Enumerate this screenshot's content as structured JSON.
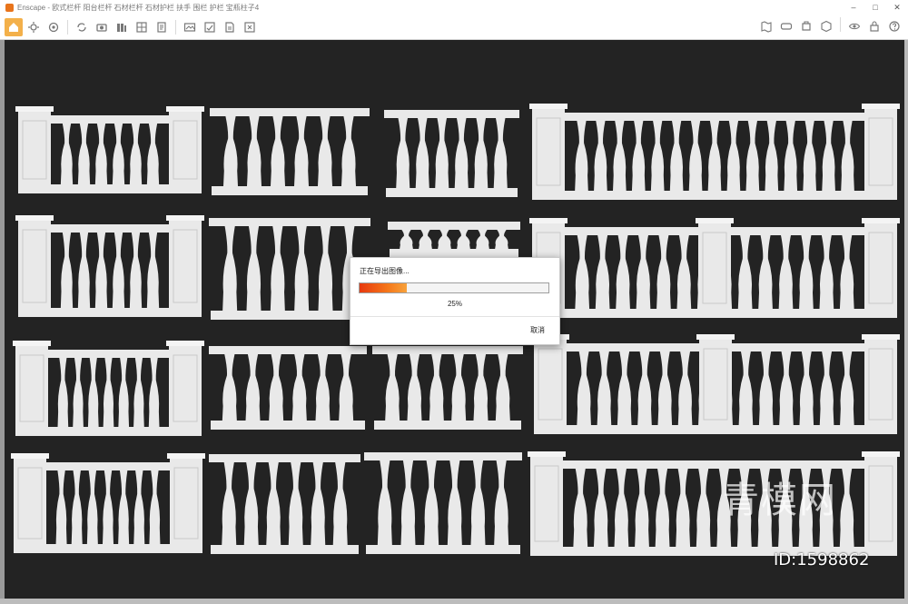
{
  "window": {
    "title": "Enscape - 欧式栏杆 阳台栏杆 石材栏杆 石材护栏 扶手 围栏 护栏 宝瓶柱子4",
    "controls": {
      "minimize": "–",
      "maximize": "□",
      "close": "✕"
    }
  },
  "toolbar": {
    "left_icons": [
      "home-icon",
      "brightness-icon",
      "settings-icon",
      "sync-icon",
      "capture-icon",
      "library-icon",
      "grid-icon",
      "compose-icon",
      "panorama-icon",
      "export-icon",
      "render-queue-icon",
      "batch-icon"
    ],
    "right_icons": [
      "map-icon",
      "vr-icon",
      "asset-icon",
      "cube-icon",
      "view-icon",
      "lock-icon",
      "help-icon"
    ],
    "accent": "#f3b04a"
  },
  "dialog": {
    "title": "正在导出图像...",
    "progress_percent": 25,
    "progress_label": "25%",
    "cancel_label": "取消"
  },
  "watermark": {
    "brand": "青模网",
    "id": "ID:1598862"
  },
  "colors": {
    "background": "#232323",
    "balustrade": "#e9e9e9",
    "progress_start": "#e7390e",
    "progress_end": "#f7a23c"
  }
}
